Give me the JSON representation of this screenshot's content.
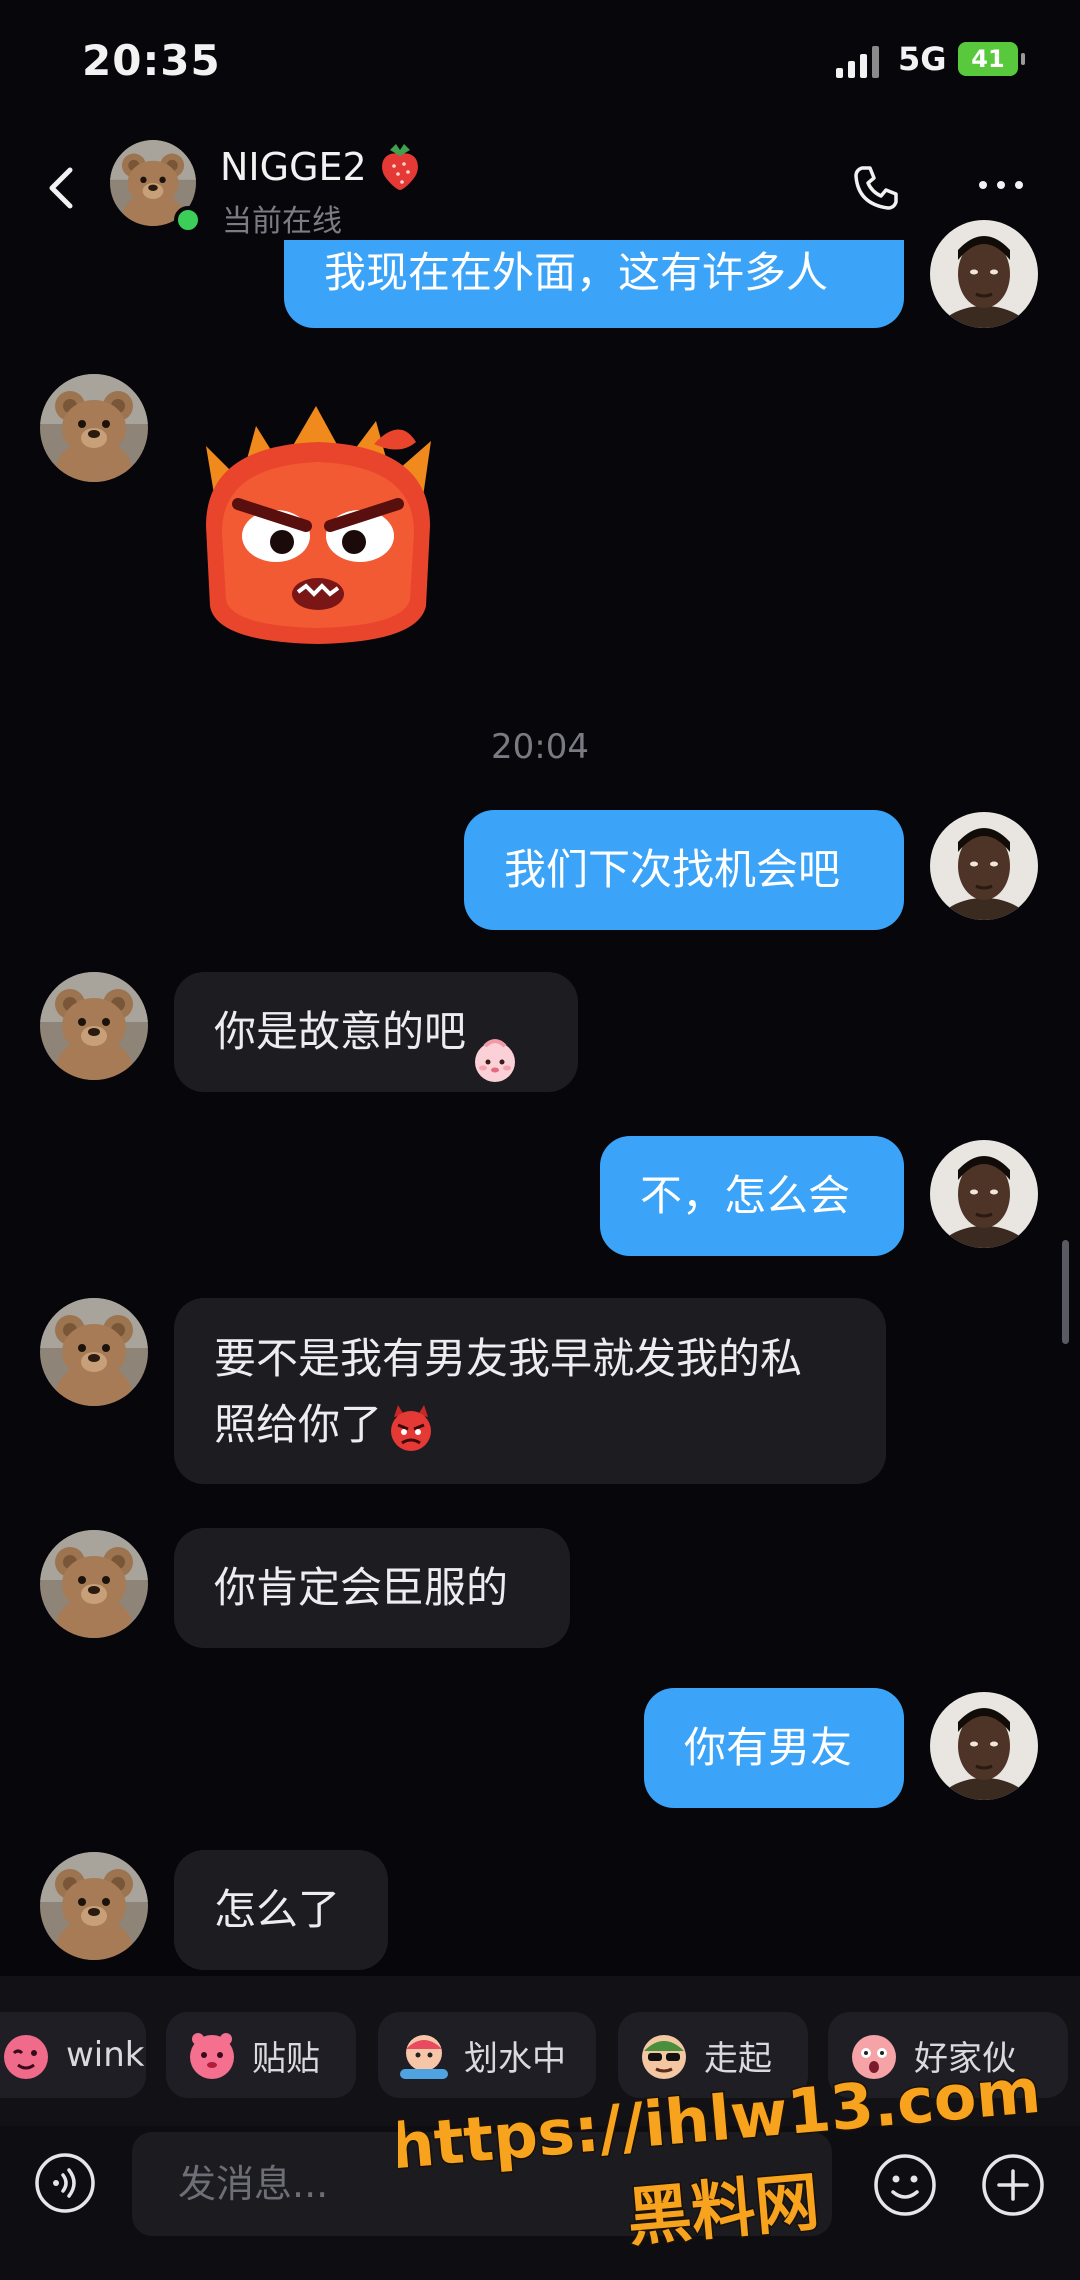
{
  "status_bar": {
    "time": "20:35",
    "network": "5G",
    "battery": "41"
  },
  "header": {
    "name": "NIGGE2",
    "status": "当前在线"
  },
  "messages": [
    {
      "side": "out",
      "text": "我现在在外面，这有许多人"
    },
    {
      "side": "in",
      "type": "sticker",
      "sticker": "angry-red-blob-sticker"
    },
    {
      "side": "time",
      "text": "20:04"
    },
    {
      "side": "out",
      "text": "我们下次找机会吧"
    },
    {
      "side": "in",
      "text": "你是故意的吧",
      "emoji": "shy-face-emoji"
    },
    {
      "side": "out",
      "text": "不，怎么会"
    },
    {
      "side": "in",
      "lines": [
        "要不是我有男友我早就发我的私",
        "照给你了"
      ],
      "emoji": "angry-devil-emoji"
    },
    {
      "side": "in",
      "text": "你肯定会臣服的"
    },
    {
      "side": "out",
      "text": "你有男友"
    },
    {
      "side": "in",
      "text": "怎么了"
    }
  ],
  "quick_stickers": [
    {
      "label": "wink"
    },
    {
      "label": "贴贴"
    },
    {
      "label": "划水中"
    },
    {
      "label": "走起"
    },
    {
      "label": "好家伙"
    }
  ],
  "input": {
    "placeholder": "发消息..."
  },
  "watermark": {
    "url": "https://ihlw13.com",
    "site": "黑料网"
  },
  "colors": {
    "outgoing": "#3ba3f8",
    "incoming": "#1c1c21",
    "background": "#07060b",
    "online": "#3bcf5a"
  }
}
